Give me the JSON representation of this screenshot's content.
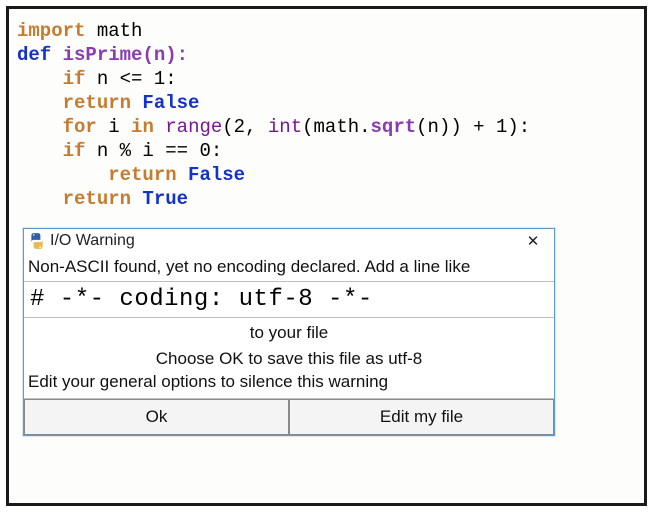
{
  "code": {
    "l1_import": "import",
    "l1_module": " math",
    "l2_def": "def",
    "l2_name": " isPrime",
    "l2_paren": "(n):",
    "l3_if": "if",
    "l3_rest": " n <= 1:",
    "l4_return": "return",
    "l4_false": " False",
    "l5_for": "for",
    "l5_i": " i ",
    "l5_in": "in",
    "l5_sp1": " ",
    "l5_range": "range",
    "l5_open": "(2, ",
    "l5_int": "int",
    "l5_open2": "(math.",
    "l5_sqrt": "sqrt",
    "l5_open3": "(n)) + 1):",
    "l6_if": "if",
    "l6_rest": " n % i == 0:",
    "l7_return": "return",
    "l7_false": " False",
    "l8_return": "return",
    "l8_true": " True"
  },
  "dialog": {
    "title": "I/O Warning",
    "line1": "Non-ASCII found, yet no encoding declared. Add a line like",
    "codeline": "# -*- coding: utf-8 -*-",
    "line2": "to your file",
    "line3": "Choose OK to save this file as utf-8",
    "line4": "Edit your general options to silence this warning",
    "ok": "Ok",
    "edit": "Edit my file",
    "close": "✕"
  }
}
